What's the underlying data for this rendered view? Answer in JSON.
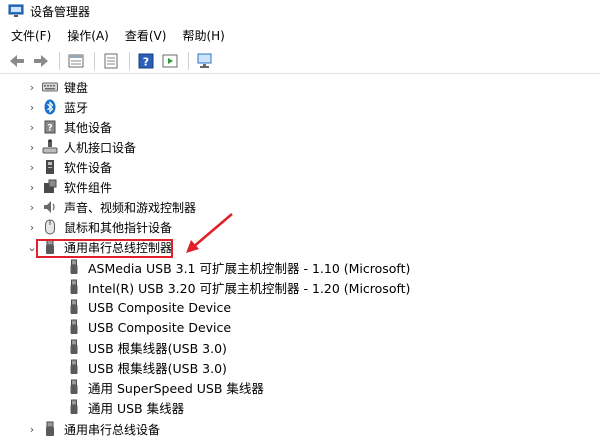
{
  "window": {
    "title": "设备管理器"
  },
  "menu": [
    "文件(F)",
    "操作(A)",
    "查看(V)",
    "帮助(H)"
  ],
  "toolbar": {
    "icons": [
      "back-icon",
      "forward-icon",
      "properties-icon",
      "update-icon",
      "help-icon",
      "run-icon",
      "scan-icon"
    ]
  },
  "tree": {
    "categories_before": [
      {
        "label": "键盘",
        "icon": "keyboard-icon"
      },
      {
        "label": "蓝牙",
        "icon": "bluetooth-icon"
      },
      {
        "label": "其他设备",
        "icon": "unknown-device-icon"
      },
      {
        "label": "人机接口设备",
        "icon": "hid-icon"
      },
      {
        "label": "软件设备",
        "icon": "software-device-icon"
      },
      {
        "label": "软件组件",
        "icon": "software-component-icon"
      },
      {
        "label": "声音、视频和游戏控制器",
        "icon": "audio-icon"
      },
      {
        "label": "鼠标和其他指针设备",
        "icon": "mouse-icon"
      }
    ],
    "expanded": {
      "label": "通用串行总线控制器",
      "icon": "usb-icon",
      "children": [
        "ASMedia USB 3.1 可扩展主机控制器 - 1.10 (Microsoft)",
        "Intel(R) USB 3.20 可扩展主机控制器 - 1.20 (Microsoft)",
        "USB Composite Device",
        "USB Composite Device",
        "USB 根集线器(USB 3.0)",
        "USB 根集线器(USB 3.0)",
        "通用 SuperSpeed USB 集线器",
        "通用 USB 集线器"
      ]
    },
    "categories_after": [
      {
        "label": "通用串行总线设备",
        "icon": "usb-device-icon"
      }
    ]
  },
  "colors": {
    "highlight": "#e0202a",
    "accent_blue": "#1a6fc9"
  }
}
